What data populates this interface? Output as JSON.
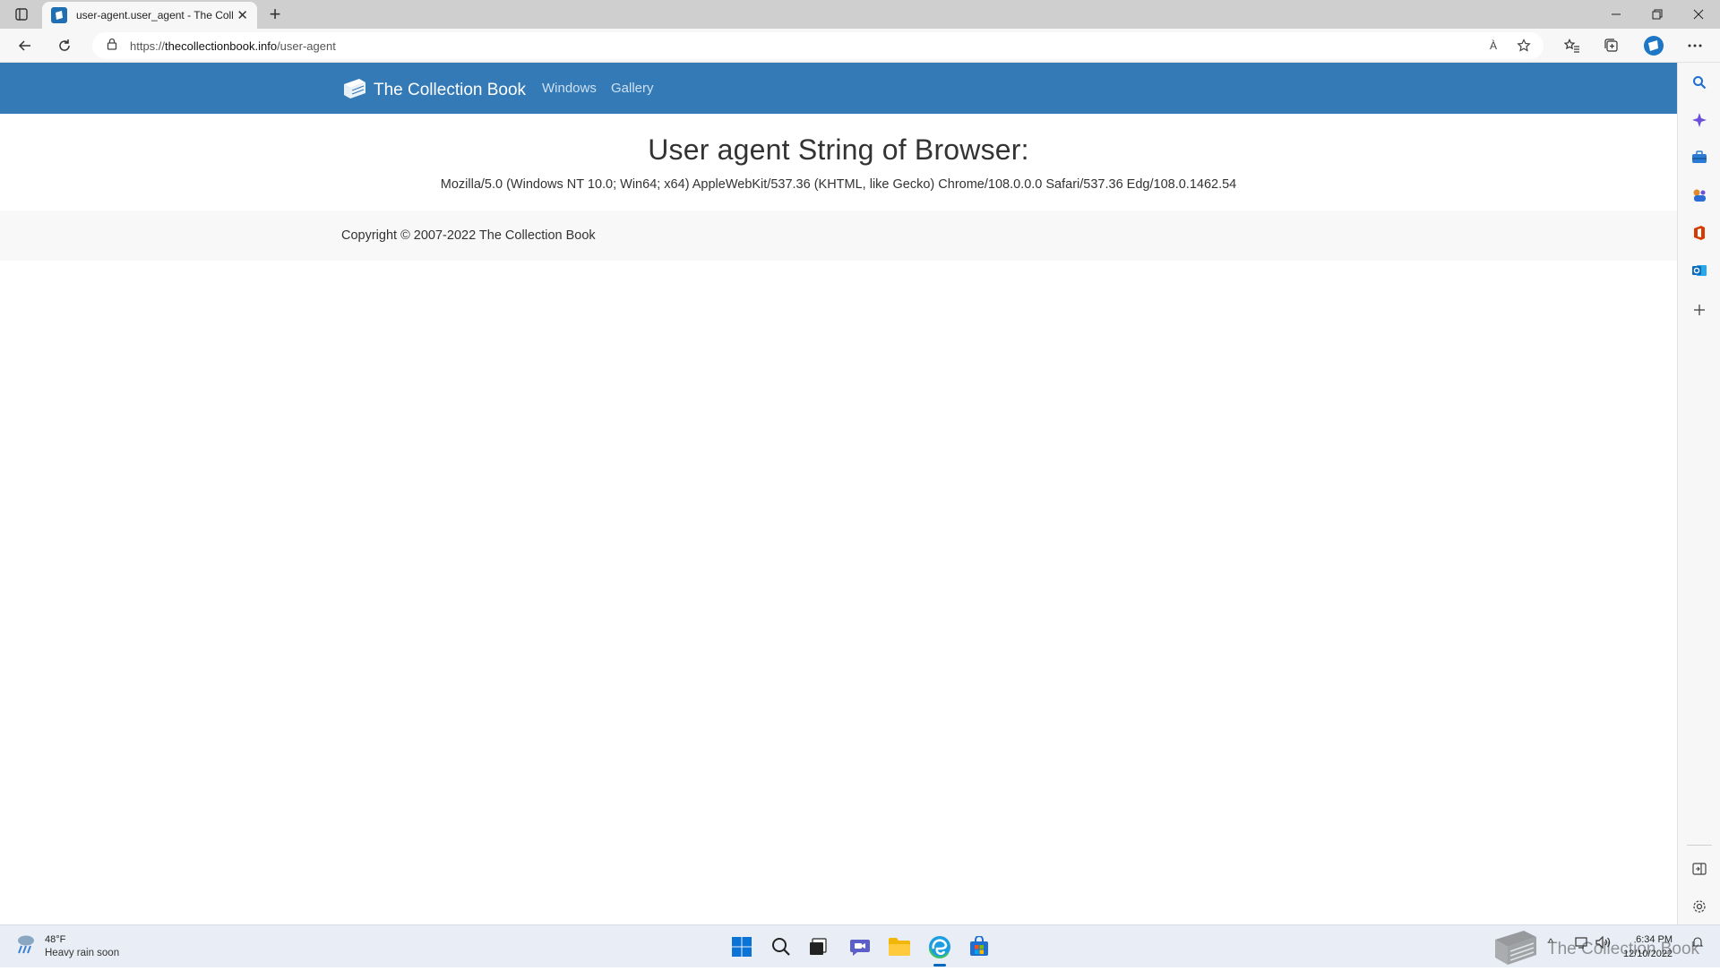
{
  "browser": {
    "tab_title": "user-agent.user_agent - The Coll",
    "url_scheme": "https://",
    "url_host": "thecollectionbook.info",
    "url_path": "/user-agent",
    "read_aloud_label": "À"
  },
  "site": {
    "brand": "The Collection Book",
    "nav": [
      "Windows",
      "Gallery"
    ],
    "heading": "User agent String of Browser:",
    "user_agent": "Mozilla/5.0 (Windows NT 10.0; Win64; x64) AppleWebKit/537.36 (KHTML, like Gecko) Chrome/108.0.0.0 Safari/537.36 Edg/108.0.1462.54",
    "copyright": "Copyright © 2007-2022 The Collection Book"
  },
  "taskbar": {
    "weather_temp": "48°F",
    "weather_condition": "Heavy rain soon",
    "time": "6:34 PM",
    "date": "12/10/2022",
    "watermark": "The Collection Book"
  },
  "colors": {
    "site_header": "#337ab7",
    "tab_bar": "#cfcfcf",
    "taskbar": "#e9eef6"
  }
}
